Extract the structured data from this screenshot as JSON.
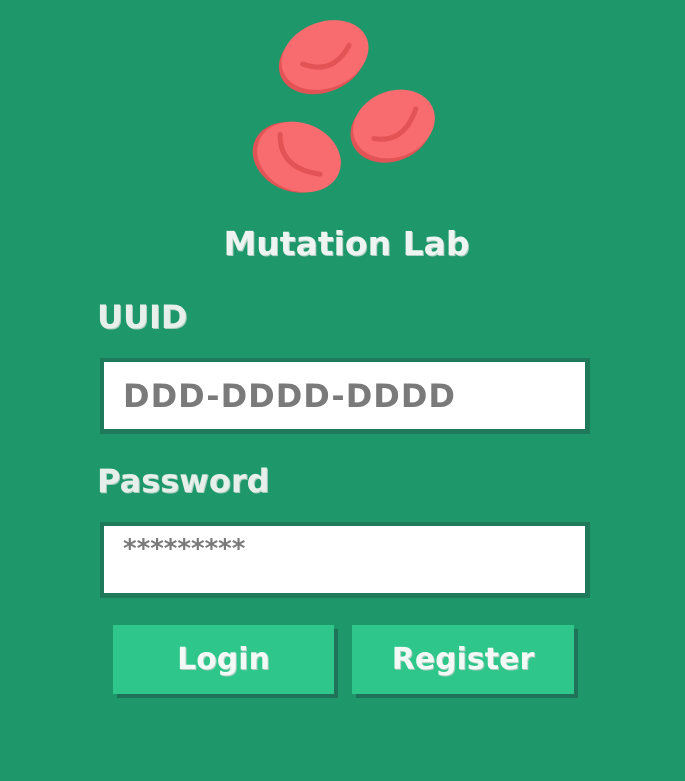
{
  "app": {
    "title": "Mutation Lab",
    "logo_icon": "red-blood-cells-icon"
  },
  "form": {
    "uuid_label": "UUID",
    "uuid_placeholder": "DDD-DDDD-DDDD",
    "password_label": "Password",
    "password_value": "*********",
    "login_label": "Login",
    "register_label": "Register"
  },
  "colors": {
    "background": "#1e976b",
    "button": "#2fc68c",
    "cell": "#f86b6e",
    "cell_shadow": "#e25355"
  }
}
